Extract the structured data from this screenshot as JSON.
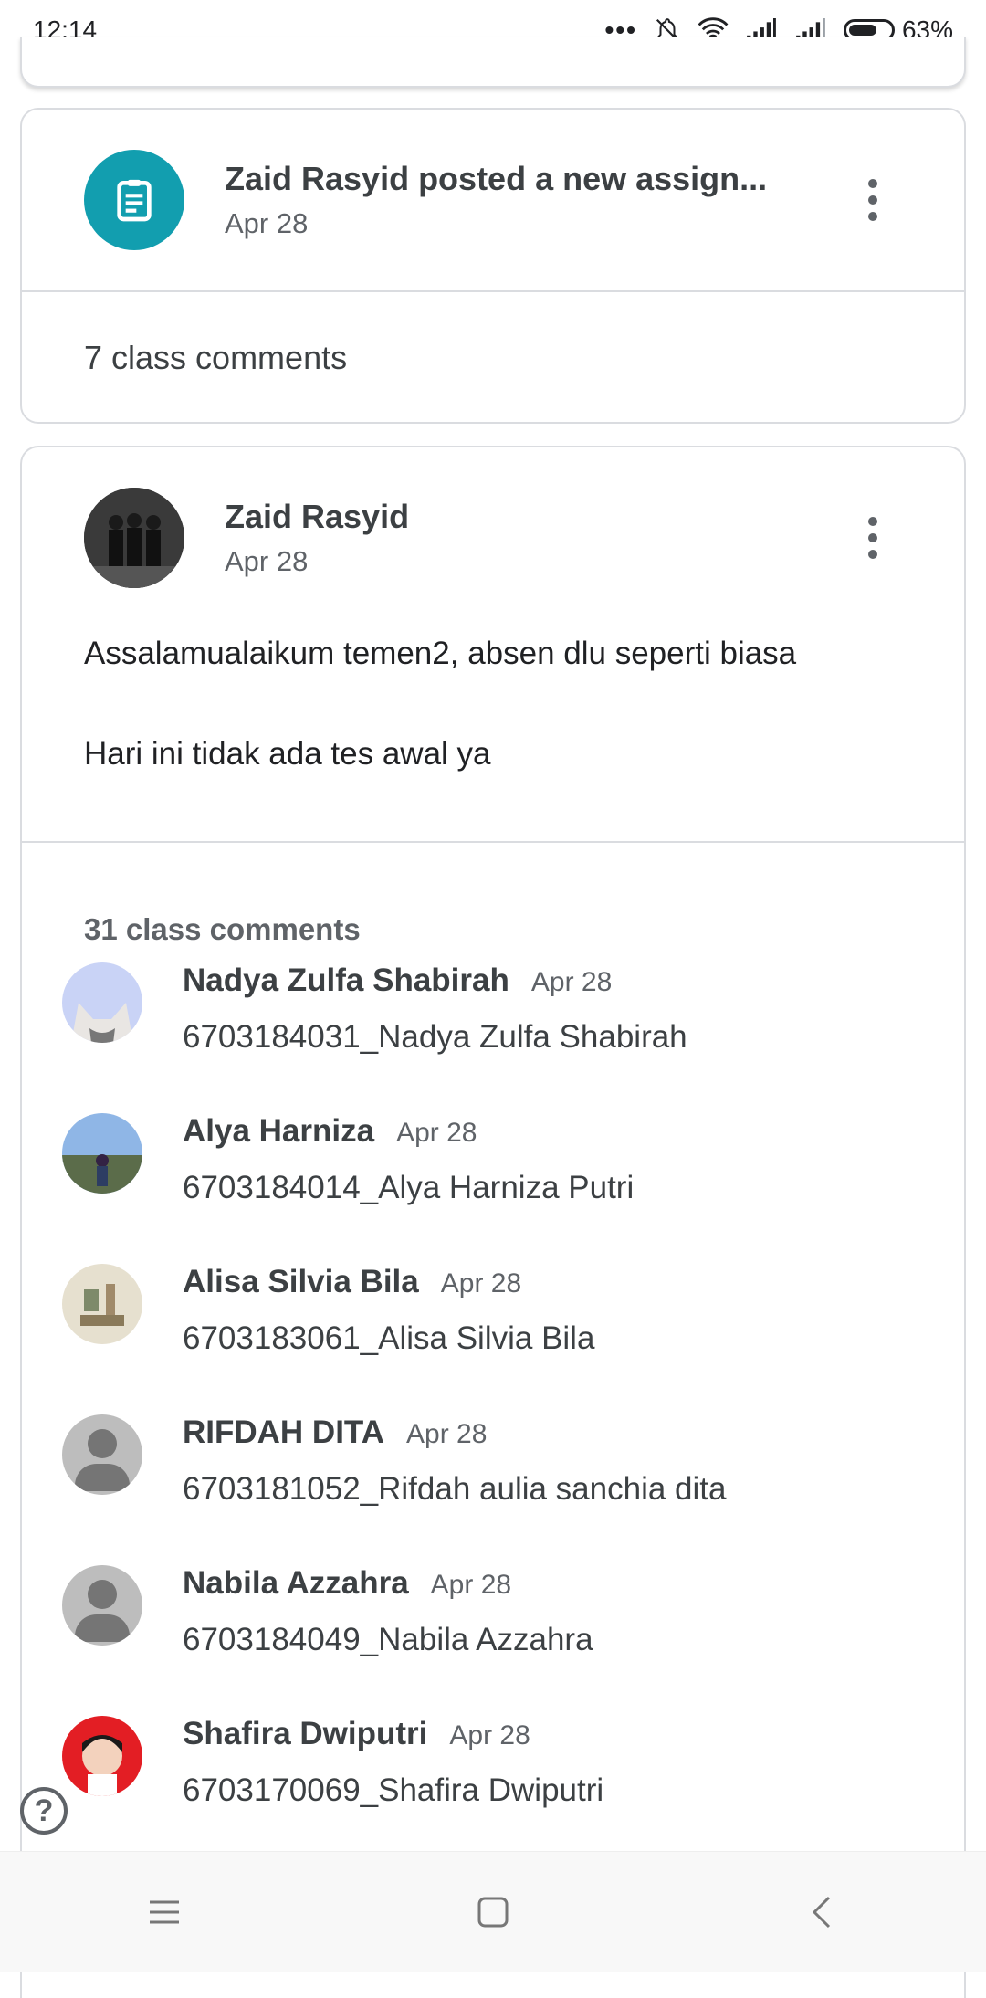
{
  "status_bar": {
    "time": "12:14",
    "battery_text": "63%",
    "battery_level": 0.63
  },
  "assignment_card": {
    "title": "Zaid Rasyid posted a new assign...",
    "date": "Apr 28",
    "comments_label": "7 class comments",
    "icon": "assignment-icon",
    "accent_color": "#129eaf"
  },
  "announcement": {
    "author": "Zaid Rasyid",
    "date": "Apr 28",
    "body_line1": "Assalamualaikum temen2, absen dlu seperti biasa",
    "body_line2": "Hari ini tidak ada tes awal ya",
    "comments_title": "31 class comments"
  },
  "comments": [
    {
      "name": "Nadya Zulfa Shabirah",
      "date": "Apr 28",
      "text": "6703184031_Nadya Zulfa Shabirah"
    },
    {
      "name": "Alya Harniza",
      "date": "Apr 28",
      "text": "6703184014_Alya Harniza Putri"
    },
    {
      "name": "Alisa Silvia Bila",
      "date": "Apr 28",
      "text": "6703183061_Alisa Silvia Bila"
    },
    {
      "name": "RIFDAH DITA",
      "date": "Apr 28",
      "text": "6703181052_Rifdah aulia sanchia dita"
    },
    {
      "name": "Nabila Azzahra",
      "date": "Apr 28",
      "text": "6703184049_Nabila Azzahra"
    },
    {
      "name": "Shafira Dwiputri",
      "date": "Apr 28",
      "text": "6703170069_Shafira Dwiputri"
    }
  ],
  "help_icon": "help-icon"
}
